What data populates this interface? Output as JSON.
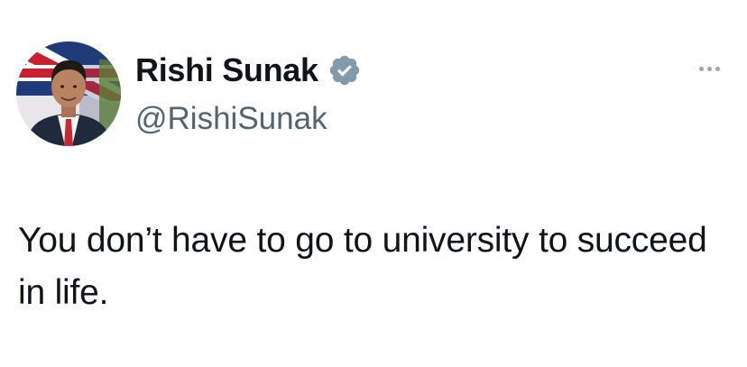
{
  "author": {
    "display_name": "Rishi Sunak",
    "handle": "@RishiSunak",
    "verified": true,
    "avatar_icon": "profile-photo-union-flag-background"
  },
  "tweet": {
    "text": "You don’t have to go to university to succeed in life."
  },
  "actions": {
    "more_icon": "more-horizontal-icon"
  },
  "colors": {
    "text_primary": "#0f1419",
    "text_secondary": "#536471",
    "verified_badge": "#829aab",
    "more_dots": "#9aa6b1",
    "background": "#ffffff"
  }
}
